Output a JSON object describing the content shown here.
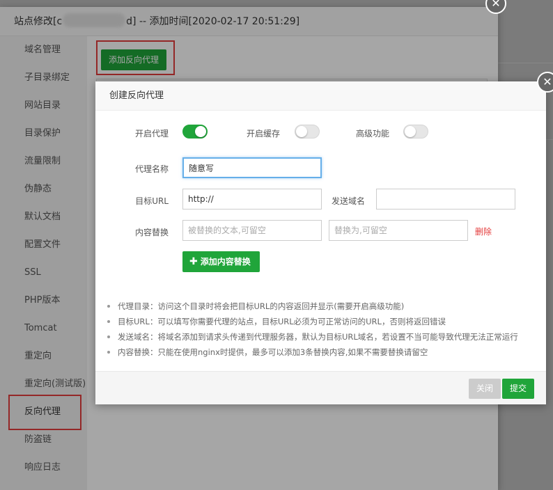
{
  "outer_dialog": {
    "title_prefix": "站点修改[c",
    "title_suffix": "d] -- 添加时间[2020-02-17 20:51:29]",
    "close_glyph": "✕",
    "add_proxy_button": "添加反向代理"
  },
  "sidebar": {
    "items": [
      {
        "label": "域名管理"
      },
      {
        "label": "子目录绑定"
      },
      {
        "label": "网站目录"
      },
      {
        "label": "目录保护"
      },
      {
        "label": "流量限制"
      },
      {
        "label": "伪静态"
      },
      {
        "label": "默认文档"
      },
      {
        "label": "配置文件"
      },
      {
        "label": "SSL"
      },
      {
        "label": "PHP版本"
      },
      {
        "label": "Tomcat"
      },
      {
        "label": "重定向"
      },
      {
        "label": "重定向(测试版)"
      },
      {
        "label": "反向代理"
      },
      {
        "label": "防盗链"
      },
      {
        "label": "响应日志"
      }
    ],
    "active_index": 13
  },
  "proxy_dialog": {
    "title": "创建反向代理",
    "close_glyph": "✕",
    "enable_proxy_label": "开启代理",
    "enable_proxy_on": true,
    "enable_cache_label": "开启缓存",
    "enable_cache_on": false,
    "advanced_label": "高级功能",
    "advanced_on": false,
    "proxy_name_label": "代理名称",
    "proxy_name_value": "随意写",
    "target_url_label": "目标URL",
    "target_url_value": "http://",
    "send_domain_label": "发送域名",
    "send_domain_value": "",
    "content_replace_label": "内容替换",
    "replace_from_placeholder": "被替换的文本,可留空",
    "replace_to_placeholder": "替换为,可留空",
    "delete_label": "删除",
    "add_content_button": "添加内容替换",
    "tips": [
      "代理目录：访问这个目录时将会把目标URL的内容返回并显示(需要开启高级功能)",
      "目标URL：可以填写你需要代理的站点，目标URL必须为可正常访问的URL，否则将返回错误",
      "发送域名：将域名添加到请求头传递到代理服务器，默认为目标URL域名，若设置不当可能导致代理无法正常运行",
      "内容替换：只能在使用nginx时提供，最多可以添加3条替换内容,如果不需要替换请留空"
    ],
    "cancel_button": "关闭",
    "submit_button": "提交"
  },
  "colors": {
    "accent_green": "#20a53a",
    "highlight_red": "#e43c3c",
    "delete_red": "#e43c3c"
  }
}
